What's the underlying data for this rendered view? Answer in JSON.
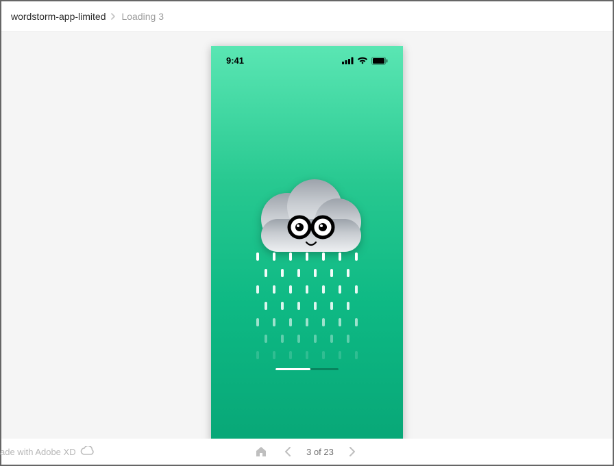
{
  "breadcrumb": {
    "project": "wordstorm-app-limited",
    "artboard": "Loading 3"
  },
  "statusbar": {
    "time": "9:41"
  },
  "progress": {
    "percent": 55
  },
  "pagination": {
    "label": "3 of 23"
  },
  "watermark": {
    "text": "ade with Adobe XD"
  }
}
